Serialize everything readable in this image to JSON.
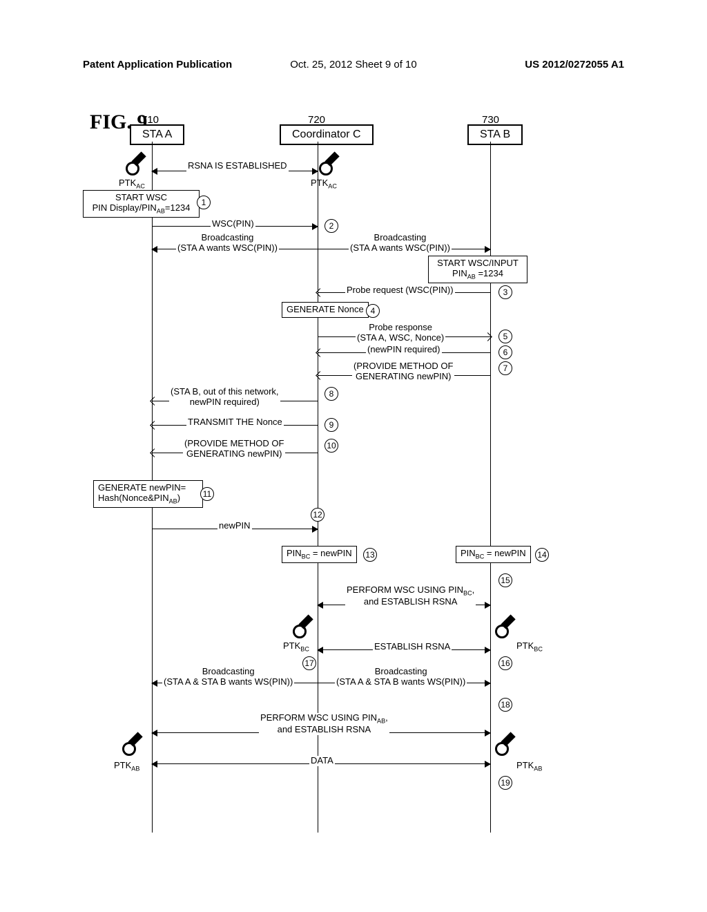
{
  "header": {
    "left": "Patent Application Publication",
    "center": "Oct. 25, 2012  Sheet 9 of 10",
    "right": "US 2012/0272055 A1"
  },
  "figure_label": "FIG.  9",
  "participants": {
    "a": {
      "label": "STA A",
      "ref": "710"
    },
    "c": {
      "label": "Coordinator C",
      "ref": "720"
    },
    "b": {
      "label": "STA B",
      "ref": "730"
    }
  },
  "keys": {
    "ptk_ac_a": "PTKAC",
    "ptk_ac_c": "PTKAC",
    "ptk_bc_c": "PTKBC",
    "ptk_bc_b": "PTKBC",
    "ptk_ab_a": "PTKAB",
    "ptk_ab_b": "PTKAB"
  },
  "boxes": {
    "start_wsc_a": "START WSC\nPIN Display/PINAB=1234",
    "gen_nonce": "GENERATE Nonce",
    "start_wsc_b": "START WSC/INPUT\nPINAB =1234",
    "gen_newpin": "GENERATE newPIN=\nHash(Nonce&PINAB)",
    "pin_bc_c": "PINBC = newPIN",
    "pin_bc_b": "PINBC = newPIN"
  },
  "messages": {
    "rsna_est": "RSNA IS ESTABLISHED",
    "wsc_pin": "WSC(PIN)",
    "bcast_a": "Broadcasting\n(STA A wants WSC(PIN))",
    "bcast_b": "Broadcasting\n(STA A wants WSC(PIN))",
    "probe_req": "Probe request (WSC(PIN))",
    "probe_resp": "Probe response\n(STA A, WSC, Nonce)",
    "newpin_req": "(newPIN required)",
    "provide_method": "(PROVIDE METHOD OF\nGENERATING newPIN)",
    "stab_out": "(STA B, out of this network,\nnewPIN required)",
    "transmit_nonce": "TRANSMIT THE Nonce",
    "provide_method_2": "(PROVIDE METHOD OF\nGENERATING newPIN)",
    "newpin": "newPIN",
    "perform_wsc_bc": "PERFORM WSC USING PINBC,\nand ESTABLISH RSNA",
    "establish_rsna": "ESTABLISH RSNA",
    "bcast_ab_1": "Broadcasting\n(STA A & STA B wants WS(PIN))",
    "bcast_ab_2": "Broadcasting\n(STA A & STA B wants WS(PIN))",
    "perform_wsc_ab": "PERFORM WSC USING PINAB,\nand ESTABLISH RSNA",
    "data": "DATA"
  }
}
